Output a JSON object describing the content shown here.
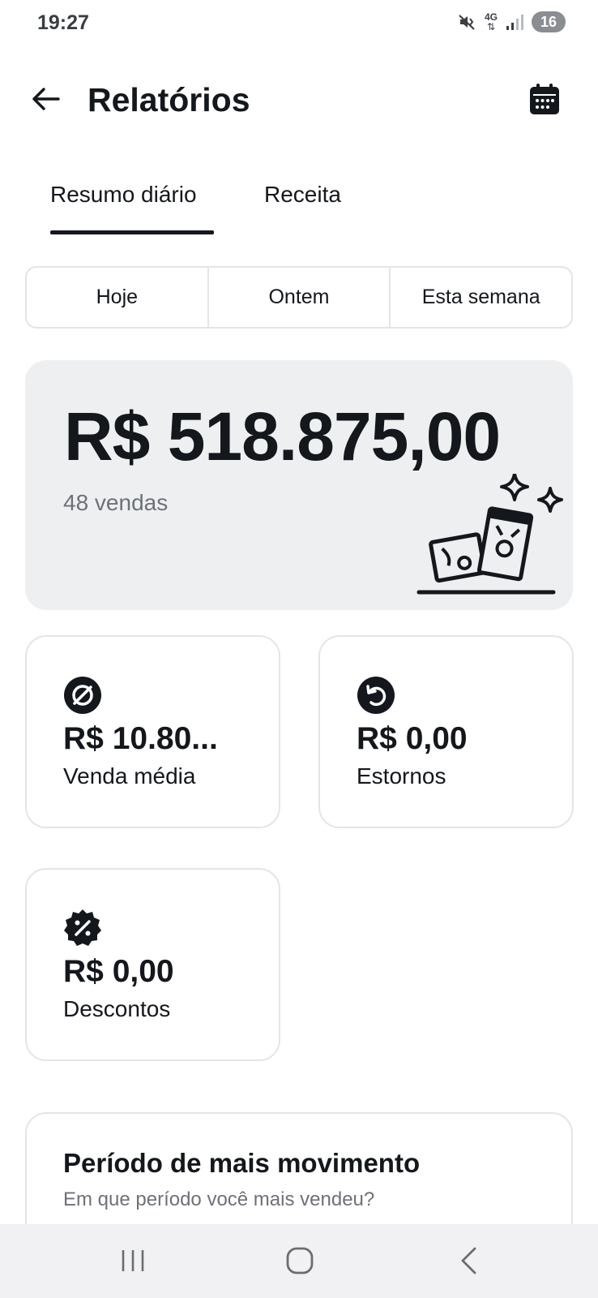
{
  "status_bar": {
    "time": "19:27",
    "network": "4G",
    "battery": "16",
    "icons": [
      "mute-vibrate-icon",
      "network-4g-icon",
      "signal-bars-icon",
      "battery-icon"
    ]
  },
  "header": {
    "title": "Relatórios",
    "back_icon": "arrow-left-icon",
    "calendar_icon": "calendar-icon"
  },
  "tabs": [
    {
      "label": "Resumo diário",
      "active": true
    },
    {
      "label": "Receita",
      "active": false
    }
  ],
  "period_filter": {
    "options": [
      "Hoje",
      "Ontem",
      "Esta semana"
    ]
  },
  "summary": {
    "total": "R$ 518.875,00",
    "sales_count": "48 vendas",
    "illustration": "money-sparkle-icon"
  },
  "metrics": {
    "average": {
      "value": "R$ 10.80...",
      "label": "Venda média",
      "icon": "average-icon"
    },
    "refunds": {
      "value": "R$ 0,00",
      "label": "Estornos",
      "icon": "refund-icon"
    },
    "discounts": {
      "value": "R$ 0,00",
      "label": "Descontos",
      "icon": "discount-icon"
    }
  },
  "busiest_period": {
    "title": "Período de mais movimento",
    "subtitle": "Em que período você mais vendeu?"
  },
  "nav_bar": {
    "icons": [
      "recents-icon",
      "home-icon",
      "back-icon"
    ]
  },
  "colors": {
    "text": "#14171c",
    "muted": "#6d7178",
    "card_bg": "#eeeff1",
    "border": "#e3e5e8"
  }
}
